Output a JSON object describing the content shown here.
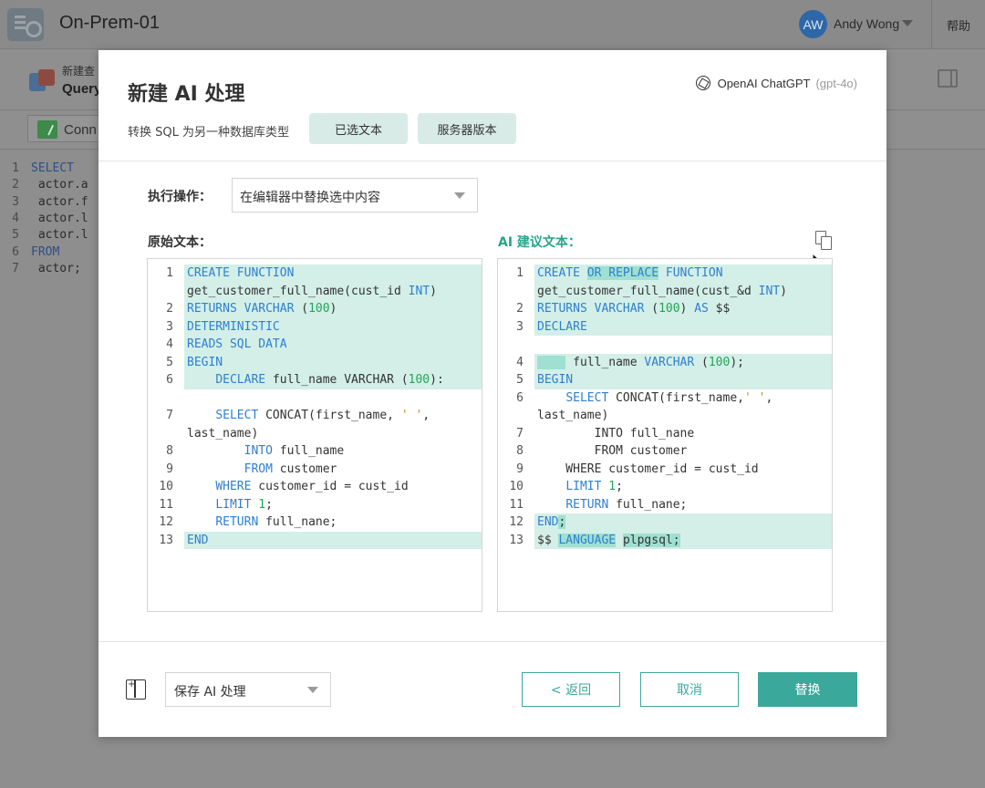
{
  "app": {
    "title": "On-Prem-01",
    "user_initials": "AW",
    "user_name": "Andy Wong",
    "help": "帮助",
    "sub_label": "新建查",
    "sub_title": "Query",
    "connection_label": "Conn",
    "editor_lines": [
      {
        "n": "1",
        "text": "SELECT",
        "kw": true
      },
      {
        "n": "2",
        "text": " actor.a",
        "kw": false
      },
      {
        "n": "3",
        "text": " actor.f",
        "kw": false
      },
      {
        "n": "4",
        "text": " actor.l",
        "kw": false
      },
      {
        "n": "5",
        "text": " actor.l",
        "kw": false
      },
      {
        "n": "6",
        "text": "FROM",
        "kw": true
      },
      {
        "n": "7",
        "text": " actor;",
        "kw": false
      }
    ]
  },
  "modal": {
    "title": "新建 AI 处理",
    "ai_provider": "OpenAI ChatGPT",
    "ai_model": "(gpt-4o)",
    "subtitle": "转换 SQL 为另一种数据库类型",
    "chip_selected_text": "已选文本",
    "chip_server_version": "服务器版本",
    "operation_label": "执行操作：",
    "operation_value": "在编辑器中替换选中内容",
    "original_label": "原始文本：",
    "ai_label": "AI 建议文本：",
    "save_select_value": "保存 AI 处理",
    "back_button": "< 返回",
    "cancel_button": "取消",
    "replace_button": "替换"
  },
  "original_code": [
    {
      "n": "1",
      "h": true,
      "parts": [
        [
          "kw",
          "CREATE FUNCTION"
        ]
      ]
    },
    {
      "n": "",
      "h": true,
      "parts": [
        [
          "t",
          "get_customer_full_name(cust_id "
        ],
        [
          "kw",
          "INT"
        ],
        [
          "t",
          ")"
        ]
      ]
    },
    {
      "n": "2",
      "h": true,
      "parts": [
        [
          "kw",
          "RETURNS VARCHAR"
        ],
        [
          "t",
          " ("
        ],
        [
          "num",
          "100"
        ],
        [
          "t",
          ")"
        ]
      ]
    },
    {
      "n": "3",
      "h": true,
      "parts": [
        [
          "kw",
          "DETERMINISTIC"
        ]
      ]
    },
    {
      "n": "4",
      "h": true,
      "parts": [
        [
          "kw",
          "READS SQL DATA"
        ]
      ]
    },
    {
      "n": "5",
      "h": true,
      "parts": [
        [
          "kw",
          "BEGIN"
        ]
      ]
    },
    {
      "n": "6",
      "h": true,
      "parts": [
        [
          "t",
          "    "
        ],
        [
          "kw",
          "DECLARE"
        ],
        [
          "t",
          " full_name VARCHAR ("
        ],
        [
          "num",
          "100"
        ],
        [
          "t",
          "):"
        ]
      ]
    },
    {
      "n": "",
      "h": false,
      "parts": [
        [
          "t",
          ""
        ]
      ]
    },
    {
      "n": "7",
      "h": false,
      "parts": [
        [
          "t",
          "    "
        ],
        [
          "kw",
          "SELECT"
        ],
        [
          "t",
          " CONCAT(first_name, "
        ],
        [
          "str",
          "' '"
        ],
        [
          "t",
          ","
        ]
      ]
    },
    {
      "n": "",
      "h": false,
      "parts": [
        [
          "t",
          "last_name)"
        ]
      ]
    },
    {
      "n": "8",
      "h": false,
      "parts": [
        [
          "t",
          "        "
        ],
        [
          "kw",
          "INTO"
        ],
        [
          "t",
          " full_name"
        ]
      ]
    },
    {
      "n": "9",
      "h": false,
      "parts": [
        [
          "t",
          "        "
        ],
        [
          "kw",
          "FROM"
        ],
        [
          "t",
          " customer"
        ]
      ]
    },
    {
      "n": "10",
      "h": false,
      "parts": [
        [
          "t",
          "    "
        ],
        [
          "kw",
          "WHERE"
        ],
        [
          "t",
          " customer_id = cust_id"
        ]
      ]
    },
    {
      "n": "11",
      "h": false,
      "parts": [
        [
          "t",
          "    "
        ],
        [
          "kw",
          "LIMIT"
        ],
        [
          "t",
          " "
        ],
        [
          "num",
          "1"
        ],
        [
          "t",
          ";"
        ]
      ]
    },
    {
      "n": "12",
      "h": false,
      "parts": [
        [
          "t",
          "    "
        ],
        [
          "kw",
          "RETURN"
        ],
        [
          "t",
          " full_nane;"
        ]
      ]
    },
    {
      "n": "13",
      "h": true,
      "parts": [
        [
          "kw",
          "END"
        ]
      ]
    }
  ],
  "ai_code": [
    {
      "n": "1",
      "h": true,
      "parts": [
        [
          "kw",
          "CREATE "
        ],
        [
          "kwm",
          "OR REPLACE"
        ],
        [
          "kw",
          " FUNCTION"
        ]
      ]
    },
    {
      "n": "",
      "h": true,
      "parts": [
        [
          "t",
          "get_customer_full_name(cust_&d "
        ],
        [
          "kw",
          "INT"
        ],
        [
          "t",
          ")"
        ]
      ]
    },
    {
      "n": "2",
      "h": true,
      "parts": [
        [
          "kw",
          "RETURNS VARCHAR"
        ],
        [
          "t",
          " ("
        ],
        [
          "num",
          "100"
        ],
        [
          "t",
          ") "
        ],
        [
          "kw",
          "AS"
        ],
        [
          "t",
          " $$"
        ]
      ]
    },
    {
      "n": "3",
      "h": true,
      "parts": [
        [
          "kw",
          "DECLARE"
        ]
      ]
    },
    {
      "n": "",
      "h": false,
      "parts": [
        [
          "t",
          ""
        ]
      ]
    },
    {
      "n": "4",
      "h": true,
      "parts": [
        [
          "m",
          "    "
        ],
        [
          "t",
          " full_name "
        ],
        [
          "kw",
          "VARCHAR"
        ],
        [
          "t",
          " ("
        ],
        [
          "num",
          "100"
        ],
        [
          "t",
          ");"
        ]
      ]
    },
    {
      "n": "5",
      "h": true,
      "parts": [
        [
          "kw",
          "BEGIN"
        ]
      ]
    },
    {
      "n": "6",
      "h": false,
      "parts": [
        [
          "t",
          "    "
        ],
        [
          "kw",
          "SELECT"
        ],
        [
          "t",
          " CONCAT(first_name,"
        ],
        [
          "str",
          "' '"
        ],
        [
          "t",
          ","
        ]
      ]
    },
    {
      "n": "",
      "h": false,
      "parts": [
        [
          "t",
          "last_name)"
        ]
      ]
    },
    {
      "n": "7",
      "h": false,
      "parts": [
        [
          "t",
          "        INTO full_nane"
        ]
      ]
    },
    {
      "n": "8",
      "h": false,
      "parts": [
        [
          "t",
          "        FROM customer"
        ]
      ]
    },
    {
      "n": "9",
      "h": false,
      "parts": [
        [
          "t",
          "    WHERE customer_id = cust_id"
        ]
      ]
    },
    {
      "n": "10",
      "h": false,
      "parts": [
        [
          "t",
          "    "
        ],
        [
          "kw",
          "LIMIT"
        ],
        [
          "t",
          " "
        ],
        [
          "num",
          "1"
        ],
        [
          "t",
          ";"
        ]
      ]
    },
    {
      "n": "11",
      "h": false,
      "parts": [
        [
          "t",
          "    "
        ],
        [
          "kw",
          "RETURN"
        ],
        [
          "t",
          " full_nane;"
        ]
      ]
    },
    {
      "n": "12",
      "h": true,
      "parts": [
        [
          "kw",
          "END"
        ],
        [
          "m",
          ";"
        ]
      ]
    },
    {
      "n": "13",
      "h": true,
      "parts": [
        [
          "t",
          "$$ "
        ],
        [
          "kwm",
          "LANGUAGE"
        ],
        [
          "t",
          " "
        ],
        [
          "m",
          "plpgsql;"
        ]
      ]
    }
  ]
}
